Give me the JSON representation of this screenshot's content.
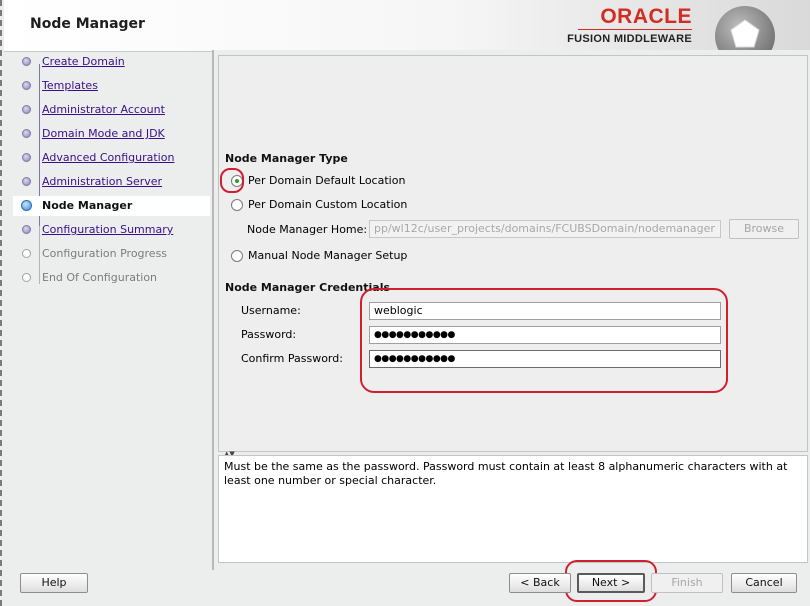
{
  "header": {
    "title": "Node Manager",
    "brand_name": "ORACLE",
    "brand_product": "FUSION MIDDLEWARE"
  },
  "steps": [
    {
      "label": "Create Domain",
      "state": "done"
    },
    {
      "label": "Templates",
      "state": "done"
    },
    {
      "label": "Administrator Account",
      "state": "done"
    },
    {
      "label": "Domain Mode and JDK",
      "state": "done"
    },
    {
      "label": "Advanced Configuration",
      "state": "done"
    },
    {
      "label": "Administration Server",
      "state": "done"
    },
    {
      "label": "Node Manager",
      "state": "current"
    },
    {
      "label": "Configuration Summary",
      "state": "next"
    },
    {
      "label": "Configuration Progress",
      "state": "todo"
    },
    {
      "label": "End Of Configuration",
      "state": "todo"
    }
  ],
  "node_manager_type": {
    "title": "Node Manager Type",
    "options": [
      {
        "label": "Per Domain Default Location",
        "selected": true
      },
      {
        "label": "Per Domain Custom Location",
        "selected": false
      },
      {
        "label": "Manual Node Manager Setup",
        "selected": false
      }
    ],
    "home_label": "Node Manager Home:",
    "home_value": "pp/wl12c/user_projects/domains/FCUBSDomain/nodemanager",
    "browse_label": "Browse"
  },
  "credentials": {
    "title": "Node Manager Credentials",
    "username_label": "Username:",
    "username_value": "weblogic",
    "password_label": "Password:",
    "password_value": "●●●●●●●●●●●",
    "confirm_label": "Confirm Password:",
    "confirm_value": "●●●●●●●●●●●"
  },
  "description": "Must be the same as the password. Password must contain at least 8 alphanumeric characters with at least one number or special character.",
  "buttons": {
    "help": "Help",
    "back": "< Back",
    "next": "Next >",
    "finish": "Finish",
    "cancel": "Cancel"
  },
  "colors": {
    "accent_red": "#d02030",
    "oracle_red": "#d22d20",
    "link": "#3a0f8a"
  }
}
